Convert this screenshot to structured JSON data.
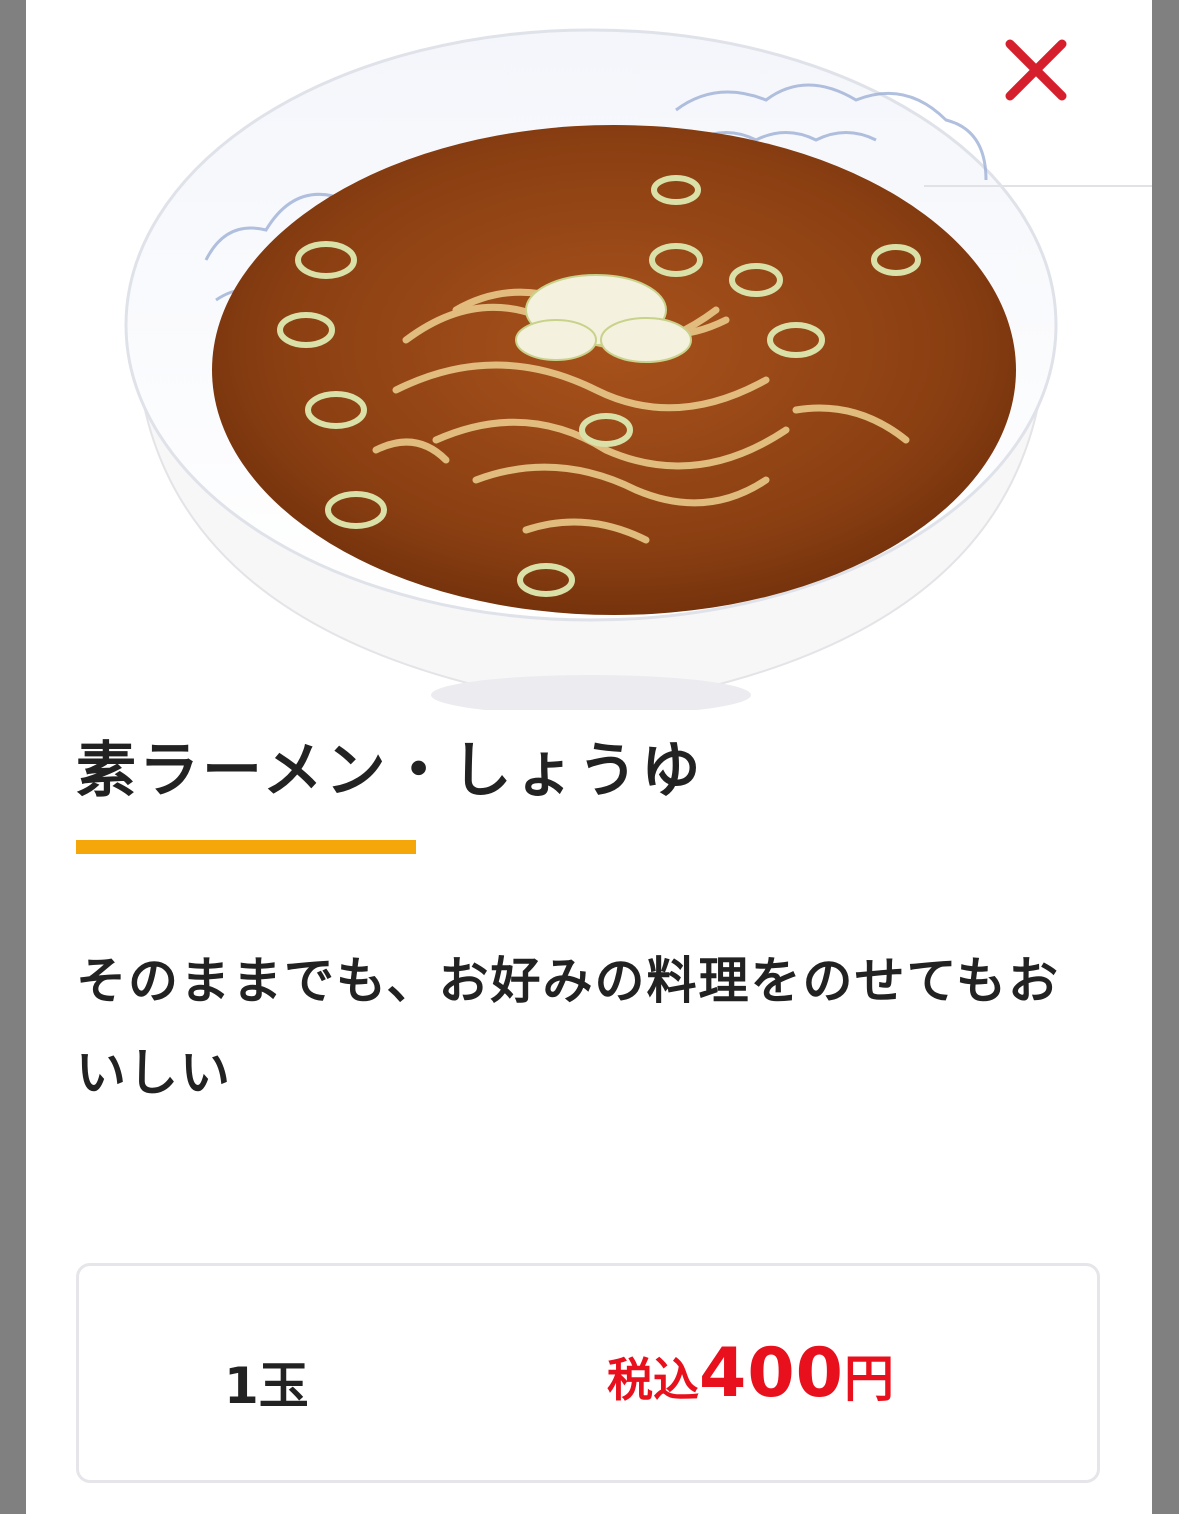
{
  "product": {
    "image_alt": "ramen-bowl",
    "title": "素ラーメン・しょうゆ",
    "description": "そのままでも、お好みの料理をのせてもおいしい"
  },
  "price_option": {
    "size": "1玉",
    "tax_label": "税込",
    "amount": "400",
    "currency": "円"
  },
  "colors": {
    "accent_underline": "#f5a70a",
    "price_red": "#e8101c",
    "close_red": "#d61f2c",
    "overlay": "#808080",
    "text": "#222222"
  },
  "icons": {
    "close": "close-icon"
  }
}
